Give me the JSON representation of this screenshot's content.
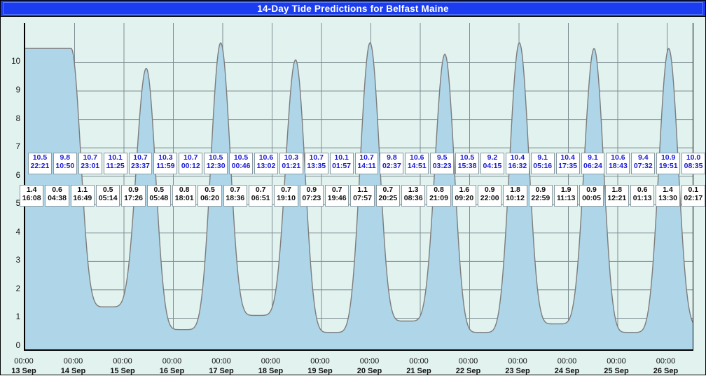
{
  "window": {
    "title": "14-Day Tide Predictions for Belfast Maine",
    "title_bg": "#1b3cf0",
    "title_color": "#ffffff"
  },
  "colors": {
    "plot_background": "#e2f2ee",
    "water_fill": "#aed6e8",
    "curve_stroke": "#7d7d7d",
    "gridline": "#7e8d92",
    "axis": "#000000",
    "high_label_text": "#1b1bd8",
    "low_label_text": "#111111",
    "label_box_bg": "#ffffff",
    "label_box_border": "#8a9aa2"
  },
  "chart_data": {
    "type": "area",
    "title": "14-Day Tide Predictions for Belfast Maine",
    "xlabel": "",
    "ylabel": "",
    "ylim": [
      0,
      10.9
    ],
    "yticks": [
      0,
      1,
      2,
      3,
      4,
      5,
      6,
      7,
      8,
      9,
      10
    ],
    "grid": true,
    "legend": "none",
    "x_tick_time": "00:00",
    "x_tick_dates": [
      "13 Sep",
      "14 Sep",
      "15 Sep",
      "16 Sep",
      "17 Sep",
      "18 Sep",
      "19 Sep",
      "20 Sep",
      "21 Sep",
      "22 Sep",
      "23 Sep",
      "24 Sep",
      "25 Sep",
      "26 Sep"
    ],
    "high_tides": [
      {
        "height": "10.5",
        "time": "22:21"
      },
      {
        "height": "9.8",
        "time": "10:50"
      },
      {
        "height": "10.7",
        "time": "23:01"
      },
      {
        "height": "10.1",
        "time": "11:25"
      },
      {
        "height": "10.7",
        "time": "23:37"
      },
      {
        "height": "10.3",
        "time": "11:59"
      },
      {
        "height": "10.7",
        "time": "00:12"
      },
      {
        "height": "10.5",
        "time": "12:30"
      },
      {
        "height": "10.5",
        "time": "00:46"
      },
      {
        "height": "10.6",
        "time": "13:02"
      },
      {
        "height": "10.3",
        "time": "01:21"
      },
      {
        "height": "10.7",
        "time": "13:35"
      },
      {
        "height": "10.1",
        "time": "01:57"
      },
      {
        "height": "10.7",
        "time": "14:11"
      },
      {
        "height": "9.8",
        "time": "02:37"
      },
      {
        "height": "10.6",
        "time": "14:51"
      },
      {
        "height": "9.5",
        "time": "03:23"
      },
      {
        "height": "10.5",
        "time": "15:38"
      },
      {
        "height": "9.2",
        "time": "04:15"
      },
      {
        "height": "10.4",
        "time": "16:32"
      },
      {
        "height": "9.1",
        "time": "05:16"
      },
      {
        "height": "10.4",
        "time": "17:35"
      },
      {
        "height": "9.1",
        "time": "06:24"
      },
      {
        "height": "10.6",
        "time": "18:43"
      },
      {
        "height": "9.4",
        "time": "07:32"
      },
      {
        "height": "10.9",
        "time": "19:51"
      },
      {
        "height": "10.0",
        "time": "08:35"
      }
    ],
    "low_tides": [
      {
        "height": "1.4",
        "time": "16:08"
      },
      {
        "height": "0.6",
        "time": "04:38"
      },
      {
        "height": "1.1",
        "time": "16:49"
      },
      {
        "height": "0.5",
        "time": "05:14"
      },
      {
        "height": "0.9",
        "time": "17:26"
      },
      {
        "height": "0.5",
        "time": "05:48"
      },
      {
        "height": "0.8",
        "time": "18:01"
      },
      {
        "height": "0.5",
        "time": "06:20"
      },
      {
        "height": "0.7",
        "time": "18:36"
      },
      {
        "height": "0.7",
        "time": "06:51"
      },
      {
        "height": "0.7",
        "time": "19:10"
      },
      {
        "height": "0.9",
        "time": "07:23"
      },
      {
        "height": "0.7",
        "time": "19:46"
      },
      {
        "height": "1.1",
        "time": "07:57"
      },
      {
        "height": "0.7",
        "time": "20:25"
      },
      {
        "height": "1.3",
        "time": "08:36"
      },
      {
        "height": "0.8",
        "time": "21:09"
      },
      {
        "height": "1.6",
        "time": "09:20"
      },
      {
        "height": "0.9",
        "time": "22:00"
      },
      {
        "height": "1.8",
        "time": "10:12"
      },
      {
        "height": "0.9",
        "time": "22:59"
      },
      {
        "height": "1.9",
        "time": "11:13"
      },
      {
        "height": "0.9",
        "time": "00:05"
      },
      {
        "height": "1.8",
        "time": "12:21"
      },
      {
        "height": "0.6",
        "time": "01:13"
      },
      {
        "height": "1.4",
        "time": "13:30"
      },
      {
        "height": "0.1",
        "time": "02:17"
      }
    ]
  }
}
